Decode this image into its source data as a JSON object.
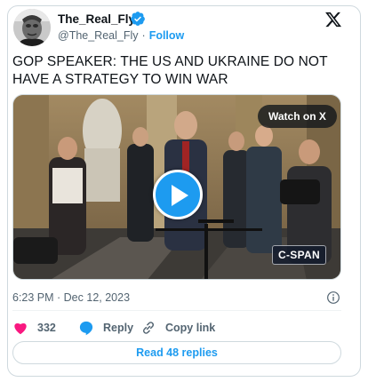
{
  "author": {
    "display_name": "The_Real_Fly",
    "handle": "@The_Real_Fly",
    "follow_label": "Follow",
    "separator": "·",
    "verified_icon": "verified-badge-icon",
    "avatar_icon": "avatar-portrait"
  },
  "header": {
    "x_logo_icon": "x-logo-icon"
  },
  "tweet": {
    "text": "GOP SPEAKER: THE US AND UKRAINE DO NOT HAVE A STRATEGY TO WIN WAR",
    "timestamp": "6:23 PM · Dec 12, 2023"
  },
  "media": {
    "watch_label": "Watch on X",
    "play_icon": "play-icon",
    "broadcaster_watermark": "C-SPAN"
  },
  "actions": {
    "like_count": "332",
    "reply_label": "Reply",
    "copy_link_label": "Copy link",
    "read_replies_label": "Read 48 replies"
  },
  "colors": {
    "accent": "#1d9bf0",
    "like_heart": "#f91880",
    "text_primary": "#0f1419",
    "text_secondary": "#536471",
    "border": "#cfd9de"
  }
}
